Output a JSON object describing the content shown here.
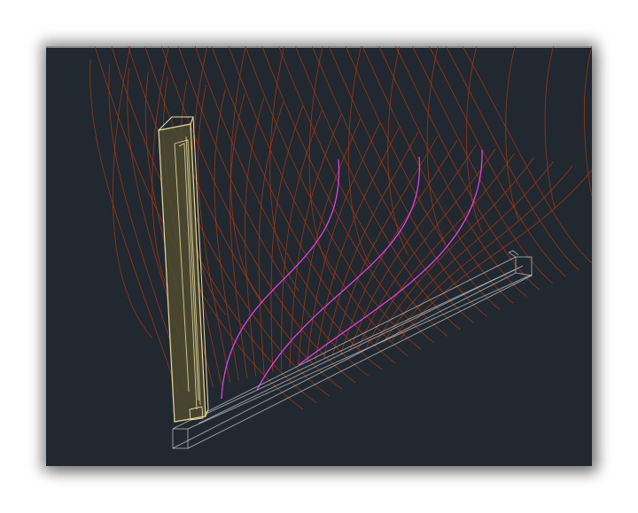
{
  "viewport": {
    "kind": "3D CAD model viewport",
    "background_color": "#212830",
    "colors": {
      "mesh_lines": "#a03614",
      "highlight_curves": "#e040e0",
      "vertical_beam_fill": "#4e4a30",
      "vertical_beam_edges": "#e8dc9c",
      "horizontal_beam_edges": "#b8bcc2"
    }
  }
}
